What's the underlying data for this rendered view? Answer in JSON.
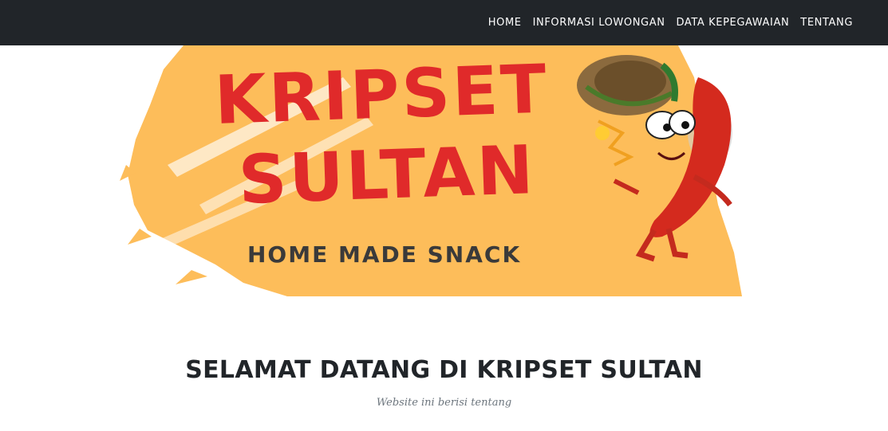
{
  "nav": {
    "items": [
      {
        "label": "HOME"
      },
      {
        "label": "INFORMASI LOWONGAN"
      },
      {
        "label": "DATA KEPEGAWAIAN"
      },
      {
        "label": "TENTANG"
      }
    ]
  },
  "banner": {
    "line1": "KRIPSET",
    "line2": "SULTAN",
    "tagline": "HOME MADE SNACK",
    "colors": {
      "splash": "#fdbd5a",
      "text": "#e02a2a",
      "tagline": "#3a3a3a",
      "chili": "#d42a1e"
    },
    "mascot": "chili-mascot-icon"
  },
  "main": {
    "title": "SELAMAT DATANG DI KRIPSET SULTAN",
    "subtitle": "Website ini berisi tentang"
  },
  "colors": {
    "navbar": "#212529",
    "title": "#212529",
    "subtitle": "#6c757d"
  }
}
